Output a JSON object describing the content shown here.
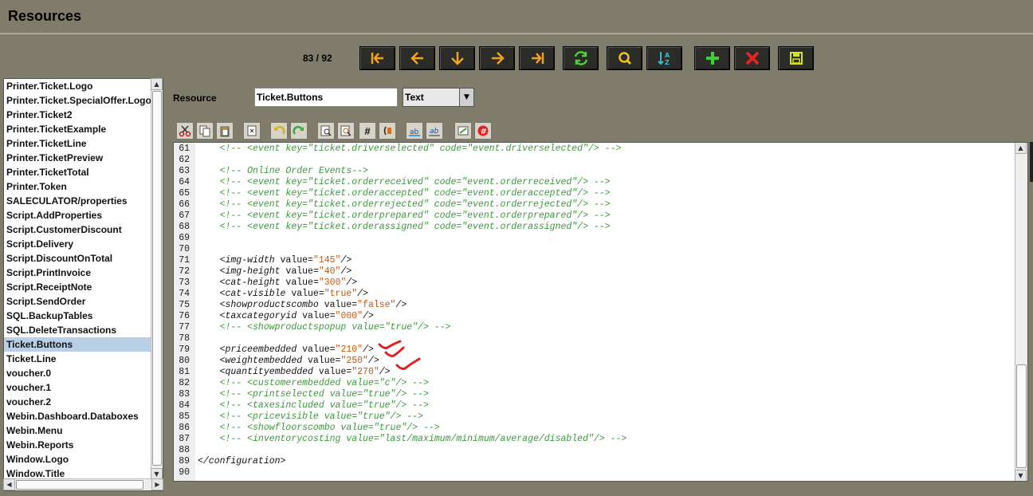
{
  "window": {
    "title": "Resources"
  },
  "toolbar": {
    "counter": "83 / 92",
    "buttons": [
      {
        "name": "first-record-button",
        "icon": "first-icon"
      },
      {
        "name": "previous-record-button",
        "icon": "arrow-left-icon"
      },
      {
        "name": "down-record-button",
        "icon": "arrow-down-icon"
      },
      {
        "name": "next-record-button",
        "icon": "arrow-right-icon"
      },
      {
        "name": "last-record-button",
        "icon": "last-icon"
      },
      {
        "name": "reload-button",
        "icon": "refresh-icon"
      },
      {
        "name": "search-button",
        "icon": "search-icon"
      },
      {
        "name": "sort-button",
        "icon": "sort-icon"
      },
      {
        "name": "new-record-button",
        "icon": "plus-icon"
      },
      {
        "name": "delete-record-button",
        "icon": "delete-icon"
      },
      {
        "name": "save-button",
        "icon": "save-icon"
      }
    ]
  },
  "resource_list": {
    "items": [
      "Printer.Ticket.Logo",
      "Printer.Ticket.SpecialOffer.Logo",
      "Printer.Ticket2",
      "Printer.TicketExample",
      "Printer.TicketLine",
      "Printer.TicketPreview",
      "Printer.TicketTotal",
      "Printer.Token",
      "SALECULATOR/properties",
      "Script.AddProperties",
      "Script.CustomerDiscount",
      "Script.Delivery",
      "Script.DiscountOnTotal",
      "Script.PrintInvoice",
      "Script.ReceiptNote",
      "Script.SendOrder",
      "SQL.BackupTables",
      "SQL.DeleteTransactions",
      "Ticket.Buttons",
      "Ticket.Line",
      "voucher.0",
      "voucher.1",
      "voucher.2",
      "Webin.Dashboard.Databoxes",
      "Webin.Menu",
      "Webin.Reports",
      "Window.Logo",
      "Window.Title"
    ],
    "selected": "Ticket.Buttons"
  },
  "form": {
    "resource_label": "Resource",
    "resource_name": "Ticket.Buttons",
    "type_value": "Text"
  },
  "editor_toolbar": [
    "cut-icon",
    "copy-icon",
    "paste-icon",
    "delete-text-icon",
    "undo-icon",
    "redo-icon",
    "find-icon",
    "replace-icon",
    "line-number-icon",
    "bracket-icon",
    "spell-icon",
    "spell-text-icon",
    "edit-icon",
    "no-hash-icon"
  ],
  "editor": {
    "lines": [
      {
        "n": "61",
        "t": "    <!-- <event key=\"ticket.driverselected\" code=\"event.driverselected\"/> -->",
        "k": "comment"
      },
      {
        "n": "62",
        "t": "",
        "k": "plain"
      },
      {
        "n": "63",
        "t": "    <!-- Online Order Events-->",
        "k": "comment"
      },
      {
        "n": "64",
        "t": "    <!-- <event key=\"ticket.orderreceived\" code=\"event.orderreceived\"/> -->",
        "k": "comment"
      },
      {
        "n": "65",
        "t": "    <!-- <event key=\"ticket.orderaccepted\" code=\"event.orderaccepted\"/> -->",
        "k": "comment"
      },
      {
        "n": "66",
        "t": "    <!-- <event key=\"ticket.orderrejected\" code=\"event.orderrejected\"/> -->",
        "k": "comment"
      },
      {
        "n": "67",
        "t": "    <!-- <event key=\"ticket.orderprepared\" code=\"event.orderprepared\"/> -->",
        "k": "comment"
      },
      {
        "n": "68",
        "t": "    <!-- <event key=\"ticket.orderassigned\" code=\"event.orderassigned\"/> -->",
        "k": "comment"
      },
      {
        "n": "69",
        "t": "",
        "k": "plain"
      },
      {
        "n": "70",
        "t": "",
        "k": "plain"
      },
      {
        "n": "71",
        "t": "    <img-width value=\"145\"/>",
        "k": "tag"
      },
      {
        "n": "72",
        "t": "    <img-height value=\"40\"/>",
        "k": "tag"
      },
      {
        "n": "73",
        "t": "    <cat-height value=\"300\"/>",
        "k": "tag"
      },
      {
        "n": "74",
        "t": "    <cat-visible value=\"true\"/>",
        "k": "tag"
      },
      {
        "n": "75",
        "t": "    <showproductscombo value=\"false\"/>",
        "k": "tag"
      },
      {
        "n": "76",
        "t": "    <taxcategoryid value=\"000\"/>",
        "k": "tag"
      },
      {
        "n": "77",
        "t": "    <!-- <showproductspopup value=\"true\"/> -->",
        "k": "comment"
      },
      {
        "n": "78",
        "t": "",
        "k": "plain"
      },
      {
        "n": "79",
        "t": "    <priceembedded value=\"210\"/>",
        "k": "tag"
      },
      {
        "n": "80",
        "t": "    <weightembedded value=\"250\"/>",
        "k": "tag"
      },
      {
        "n": "81",
        "t": "    <quantityembedded value=\"270\"/>",
        "k": "tag"
      },
      {
        "n": "82",
        "t": "    <!-- <customerembedded value=\"c\"/> -->",
        "k": "comment"
      },
      {
        "n": "83",
        "t": "    <!-- <printselected value=\"true\"/> -->",
        "k": "comment"
      },
      {
        "n": "84",
        "t": "    <!-- <taxesincluded value=\"true\"/> -->",
        "k": "comment"
      },
      {
        "n": "85",
        "t": "    <!-- <pricevisible value=\"true\"/> -->",
        "k": "comment"
      },
      {
        "n": "86",
        "t": "    <!-- <showfloorscombo value=\"true\"/> -->",
        "k": "comment"
      },
      {
        "n": "87",
        "t": "    <!-- <inventorycosting value=\"last/maximum/minimum/average/disabled\"/> -->",
        "k": "comment"
      },
      {
        "n": "88",
        "t": "",
        "k": "plain"
      },
      {
        "n": "89",
        "t": "</configuration>",
        "k": "tag"
      },
      {
        "n": "90",
        "t": "",
        "k": "plain"
      }
    ]
  },
  "colors": {
    "background": "#807c6c",
    "comment": "#3b9a3b",
    "string": "#c55a11",
    "selection": "#b8cfe5",
    "annotation": "#e0201f"
  }
}
